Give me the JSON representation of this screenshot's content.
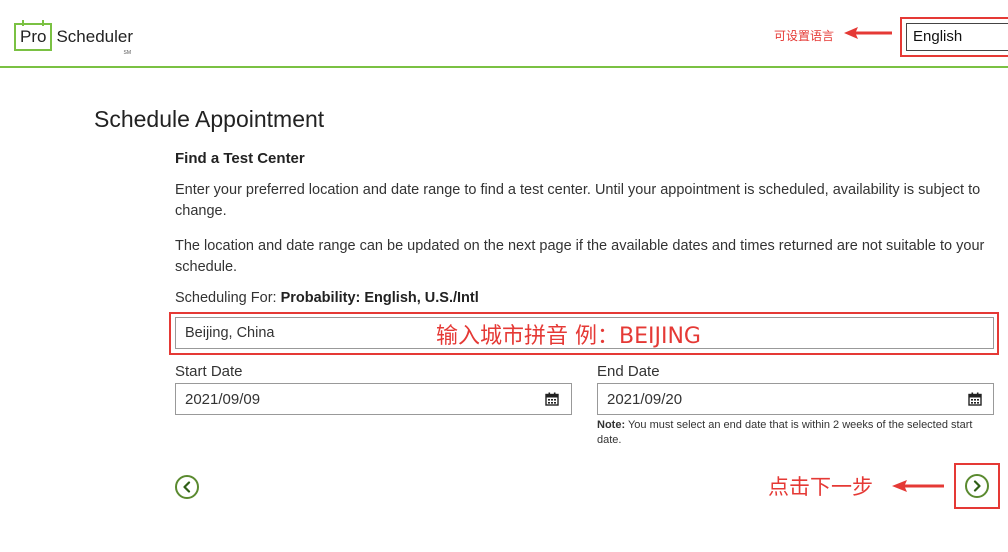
{
  "header": {
    "logo_pro": "Pro",
    "logo_scheduler": "Scheduler",
    "logo_sm": "SM",
    "language_hint": "可设置语言",
    "language_select": "English"
  },
  "main": {
    "title": "Schedule Appointment",
    "section_title": "Find a Test Center",
    "paragraph1": "Enter your preferred location and date range to find a test center. Until your appointment is scheduled, availability is subject to change.",
    "paragraph2": "The location and date range can be updated on the next page if the available dates and times returned are not suitable to your schedule.",
    "scheduling_for_label": "Scheduling For: ",
    "scheduling_for_value": "Probability: English, U.S./Intl",
    "location_value": "Beijing, China",
    "location_hint": "输入城市拼音  例：BEIJING",
    "start_date_label": "Start Date",
    "start_date_value": "2021/09/09",
    "end_date_label": "End Date",
    "end_date_value": "2021/09/20",
    "note_label": "Note:",
    "note_text": " You must select an end date that is within 2 weeks of the selected start date.",
    "next_hint": "点击下一步"
  },
  "colors": {
    "brand_green": "#7ac143",
    "nav_green": "#5a8a2f",
    "annotation_red": "#e53935"
  },
  "icons": [
    "calendar-icon",
    "chevron-left-icon",
    "chevron-right-icon",
    "arrow-left-icon"
  ]
}
